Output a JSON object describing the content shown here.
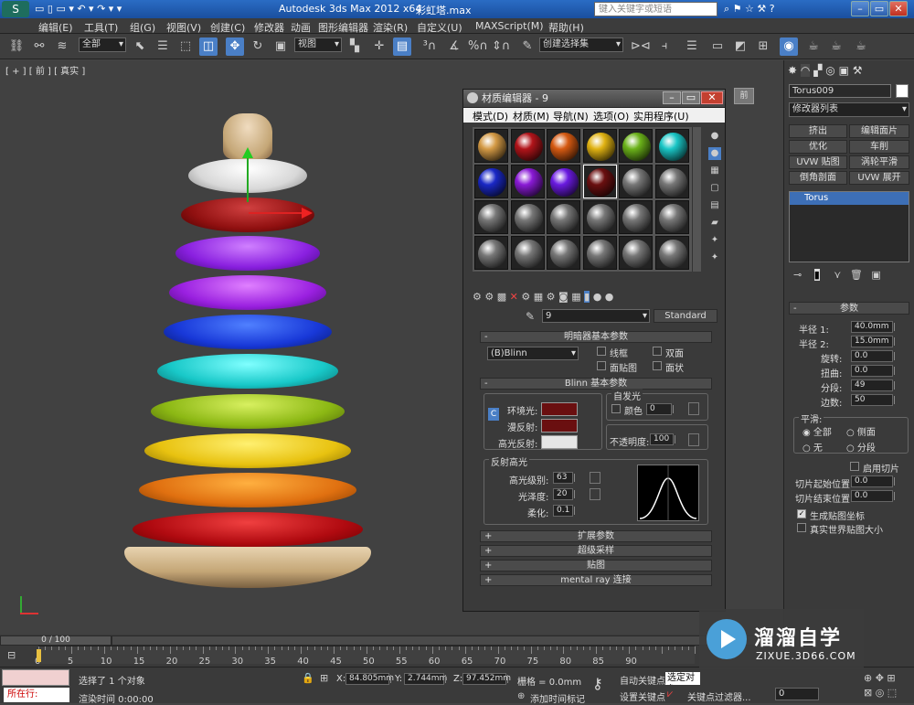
{
  "titlebar": {
    "app_title": "Autodesk 3ds Max  2012 x64",
    "file": "彩虹塔.max",
    "search_placeholder": "键入关键字或短语"
  },
  "menu": [
    "编辑(E)",
    "工具(T)",
    "组(G)",
    "视图(V)",
    "创建(C)",
    "修改器",
    "动画",
    "图形编辑器",
    "渲染(R)",
    "自定义(U)",
    "MAXScript(M)",
    "帮助(H)"
  ],
  "toolbar": {
    "selection_filter": "全部",
    "ref_coord": "视图",
    "named_selection": "创建选择集"
  },
  "viewport": {
    "label_plus": "[ + ]",
    "label_view": "[ 前 ]",
    "label_shade": "[ 真实 ]"
  },
  "material_editor": {
    "title": "材质编辑器 - 9",
    "menus": [
      "模式(D)",
      "材质(M)",
      "导航(N)",
      "选项(O)",
      "实用程序(U)"
    ],
    "slot_colors": [
      "#d49a45",
      "#b2141a",
      "#d65a12",
      "#e0b212",
      "#6bb21a",
      "#1ac6c6",
      "#1a28c6",
      "#8a1ad6",
      "#6a1ae0",
      "#6a0f10",
      "#777",
      "#777",
      "#777",
      "#777",
      "#777",
      "#777",
      "#777",
      "#777",
      "#777",
      "#777",
      "#777",
      "#777",
      "#777",
      "#777"
    ],
    "material_name": "9",
    "material_type": "Standard",
    "shader_header": "明暗器基本参数",
    "shader": "(B)Blinn",
    "wire": "线框",
    "two_sided": "双面",
    "face_map": "面贴图",
    "faceted": "面状",
    "blinn_header": "Blinn 基本参数",
    "ambient": "环境光:",
    "diffuse": "漫反射:",
    "specular": "高光反射:",
    "self_illum": "自发光",
    "color_label": "颜色",
    "self_illum_value": "0",
    "opacity_label": "不透明度:",
    "opacity": "100",
    "spec_highlights": "反射高光",
    "spec_level_label": "高光级别:",
    "spec_level": "63",
    "gloss_label": "光泽度:",
    "gloss": "20",
    "soften_label": "柔化:",
    "soften": "0.1",
    "ambient_color": "#6a0f10",
    "diffuse_color": "#6a0f10",
    "specular_color": "#e6e6e6",
    "rollouts": [
      "扩展参数",
      "超级采样",
      "贴图",
      "mental ray 连接"
    ],
    "rollout_sign": "+",
    "minus_sign": "-",
    "lock_c": "C"
  },
  "command_panel": {
    "object_name": "Torus009",
    "modifier_list": "修改器列表",
    "buttons": [
      "挤出",
      "编辑面片",
      "优化",
      "车削",
      "UVW 贴图",
      "涡轮平滑",
      "倒角剖面",
      "UVW 展开"
    ],
    "stack_item": "Torus",
    "params_header": "参数",
    "radius1_label": "半径 1:",
    "radius1": "40.0mm",
    "radius2_label": "半径 2:",
    "radius2": "15.0mm",
    "rotation_label": "旋转:",
    "rotation": "0.0",
    "twist_label": "扭曲:",
    "twist": "0.0",
    "segments_label": "分段:",
    "segments": "49",
    "sides_label": "边数:",
    "sides": "50",
    "smooth_label": "平滑:",
    "smooth_options": [
      "全部",
      "侧面",
      "无",
      "分段"
    ],
    "slice_on": "启用切片",
    "slice_from_label": "切片起始位置:",
    "slice_from": "0.0",
    "slice_to_label": "切片结束位置:",
    "slice_to": "0.0",
    "gen_map": "生成贴图坐标",
    "real_world": "真实世界贴图大小"
  },
  "timeline": {
    "frame": "0 / 100",
    "ticks": [
      "0",
      "5",
      "10",
      "15",
      "20",
      "25",
      "30",
      "35",
      "40",
      "45",
      "50",
      "55",
      "60",
      "65",
      "70",
      "75",
      "80",
      "85",
      "90"
    ]
  },
  "status": {
    "running": "所在行:",
    "selected": "选择了 1 个对象",
    "render_time": "渲染时间  0:00:00",
    "x_label": "X:",
    "x": "84.805mm",
    "y_label": "Y:",
    "y": "2.744mm",
    "z_label": "Z:",
    "z": "97.452mm",
    "grid": "栅格 = 0.0mm",
    "add_tag": "添加时间标记",
    "auto_key": "自动关键点",
    "selected_obj": "选定对象",
    "set_key": "设置关键点",
    "key_filter": "关键点过滤器...",
    "frame_value": "0"
  },
  "watermark": {
    "brand": "溜溜自学",
    "url": "ZIXUE.3D66.COM"
  }
}
